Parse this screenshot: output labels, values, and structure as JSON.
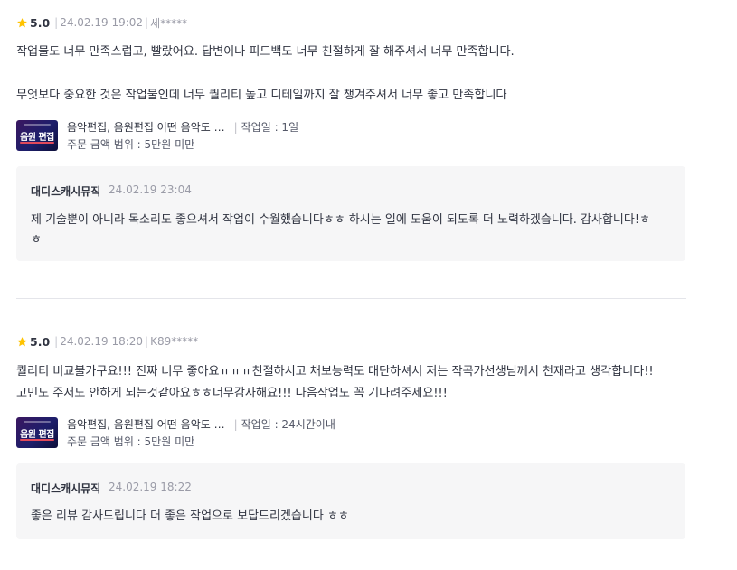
{
  "reviews": [
    {
      "rating": "5.0",
      "date": "24.02.19 19:02",
      "user": "세*****",
      "lines": [
        "작업물도 너무 만족스럽고, 빨랐어요. 답변이나 피드백도 너무 친절하게 잘 해주셔서 너무 만족합니다.",
        "무엇보다 중요한 것은 작업물인데 너무 퀄리티 높고 디테일까지 잘 챙겨주셔서 너무 좋고 만족합니다"
      ],
      "service": {
        "thumb_text": "음원 편집",
        "title": "음악편집, 음원편집 어떤 음악도 …",
        "period": "작업일 : 1일",
        "price": "주문 금액 범위 : 5만원 미만"
      },
      "reply": {
        "name": "대디스캐시뮤직",
        "date": "24.02.19 23:04",
        "lines": [
          "제 기술뿐이 아니라 목소리도 좋으셔서 작업이 수월했습니다ㅎㅎ 하시는 일에 도움이 되도록 더 노력하겠습니다. 감사합니다!ㅎ",
          "ㅎ"
        ]
      }
    },
    {
      "rating": "5.0",
      "date": "24.02.19 18:20",
      "user": "K89*****",
      "lines": [
        "퀄리티 비교불가구요!!! 진짜 너무 좋아요ㅠㅠㅠ친절하시고 채보능력도 대단하셔서 저는 작곡가선생님께서 천재라고 생각합니다!!",
        "고민도 주저도 안하게 되는것같아요ㅎㅎ너무감사해요!!! 다음작업도 꼭 기다려주세요!!!"
      ],
      "service": {
        "thumb_text": "음원 편집",
        "title": "음악편집, 음원편집 어떤 음악도 …",
        "period": "작업일 : 24시간이내",
        "price": "주문 금액 범위 : 5만원 미만"
      },
      "reply": {
        "name": "대디스캐시뮤직",
        "date": "24.02.19 18:22",
        "lines": [
          "좋은 리뷰 감사드립니다 더 좋은 작업으로 보답드리겠습니다 ㅎㅎ"
        ]
      }
    }
  ],
  "colors": {
    "star": "#ffc300",
    "reply_bg": "#f6f6f7",
    "divider": "#e4e5ea"
  },
  "icons": {
    "rating": "star-icon"
  }
}
